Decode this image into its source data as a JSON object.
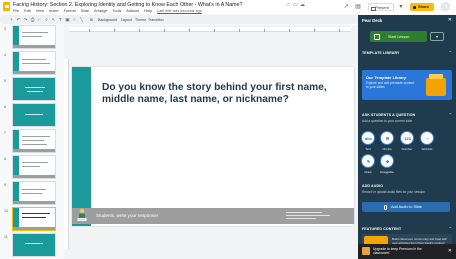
{
  "header": {
    "doc_title": "Facing History: Section 2. Exploring Identity and Getting to Know Each Other - What's in A Name?",
    "menus": [
      "File",
      "Edit",
      "View",
      "Insert",
      "Format",
      "Slide",
      "Arrange",
      "Tools",
      "Addons",
      "Help"
    ],
    "last_edit": "Last edit was seconds ago",
    "present_label": "Present",
    "share_label": "Share"
  },
  "toolbar": {
    "background_label": "Background",
    "layout_label": "Layout",
    "theme_label": "Theme",
    "transition_label": "Transition"
  },
  "filmstrip": {
    "slide_numbers": [
      "3",
      "4",
      "5",
      "6",
      "7",
      "8",
      "9",
      "10",
      "11"
    ]
  },
  "slide": {
    "heading": "Do you know the story behind your first name, middle name, last name, or nickname?",
    "footer_prompt": "Students, write your response!"
  },
  "pear_deck": {
    "title": "Pear Deck",
    "close_icon": "✕",
    "start_lesson_label": "Start Lesson",
    "template_library_label": "TEMPLATE LIBRARY",
    "template_card_title": "Our Template Library",
    "template_card_text": "Explore and add premade content to your slides",
    "ask_label": "ASK STUDENTS A QUESTION",
    "ask_desc": "Add a question to your current slide",
    "question_types": [
      "Text",
      "Choice",
      "Number",
      "Website",
      "Draw",
      "Draggable"
    ],
    "question_glyphs": [
      "abc",
      "☰",
      "123",
      "⋯",
      "✎",
      "✥"
    ],
    "add_audio_label": "ADD AUDIO",
    "add_audio_desc": "Record or upload audio files for your session",
    "add_audio_button": "Add Audio to Slide",
    "featured_label": "FEATURED CONTENT",
    "featured_text": "Build classroom community and trust with new activities from Pear Deck's partner!",
    "upgrade_text": "Upgrade to keep Premium in the classroom!"
  },
  "colors": {
    "teal": "#1a9a9a",
    "pear_navy": "#1f3b4d",
    "start_green": "#2e7d32",
    "share_yellow": "#fbbc04"
  }
}
